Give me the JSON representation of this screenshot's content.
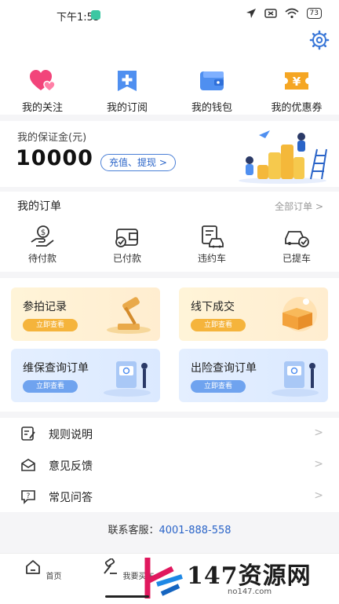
{
  "status_bar": {
    "time": "下午1:55",
    "battery": "73"
  },
  "quick_actions": [
    {
      "label": "我的关注",
      "icon": "heart-icon"
    },
    {
      "label": "我的订阅",
      "icon": "subscribe-plus-icon"
    },
    {
      "label": "我的钱包",
      "icon": "wallet-icon"
    },
    {
      "label": "我的优惠券",
      "icon": "coupon-yen-icon"
    }
  ],
  "deposit": {
    "title": "我的保证金(元)",
    "amount": "10000",
    "action_label": "充值、提现 >"
  },
  "orders": {
    "title": "我的订单",
    "all_label": "全部订单 >",
    "items": [
      {
        "label": "待付款",
        "icon": "pending-payment-icon"
      },
      {
        "label": "已付款",
        "icon": "paid-icon"
      },
      {
        "label": "违约车",
        "icon": "breach-car-icon"
      },
      {
        "label": "已提车",
        "icon": "picked-up-car-icon"
      }
    ]
  },
  "cards": [
    {
      "title": "参拍记录",
      "button": "立即查看"
    },
    {
      "title": "线下成交",
      "button": "立即查看"
    },
    {
      "title": "维保查询订单",
      "button": "立即查看"
    },
    {
      "title": "出险查询订单",
      "button": "立即查看"
    }
  ],
  "menu": [
    {
      "label": "规则说明",
      "icon": "rules-icon"
    },
    {
      "label": "意见反馈",
      "icon": "feedback-icon"
    },
    {
      "label": "常见问答",
      "icon": "faq-icon"
    }
  ],
  "service": {
    "label": "联系客服：",
    "phone": "4001-888-558"
  },
  "bottom_nav": [
    {
      "label": "首页",
      "icon": "home-icon"
    },
    {
      "label": "我要买车",
      "icon": "auction-hammer-icon"
    }
  ],
  "watermark": {
    "main": "147资源网",
    "sub": "no147.com"
  },
  "colors": {
    "accent": "#2a64c8",
    "pink": "#f2447a",
    "orange": "#f5a623",
    "blue": "#4f8ff0"
  }
}
